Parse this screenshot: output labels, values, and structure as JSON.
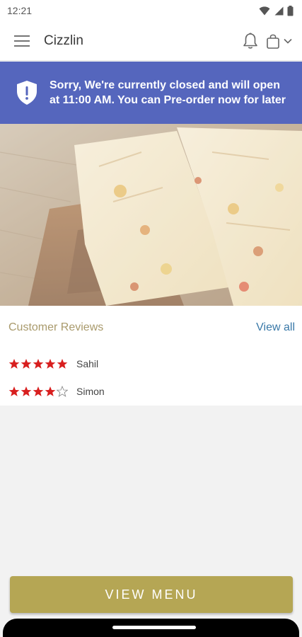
{
  "status_bar": {
    "time": "12:21",
    "icons": [
      "wifi-icon",
      "signal-icon",
      "battery-icon"
    ]
  },
  "app_bar": {
    "title": "Cizzlin",
    "icons": [
      "hamburger-menu-icon",
      "bell-icon",
      "shopping-bag-icon",
      "chevron-down-icon"
    ]
  },
  "banner": {
    "message": "Sorry, We're currently closed and will open at 11:00 AM. You can Pre-order now for later",
    "icon": "shield-alert-icon",
    "color": "#5566bd"
  },
  "reviews": {
    "title": "Customer Reviews",
    "view_all": "View all",
    "items": [
      {
        "name": "Sahil",
        "rating": 5,
        "max": 5
      },
      {
        "name": "Simon",
        "rating": 4,
        "max": 5
      }
    ],
    "star_color": "#d81f1f"
  },
  "cta": {
    "label": "VIEW MENU",
    "color": "#b5a654"
  }
}
